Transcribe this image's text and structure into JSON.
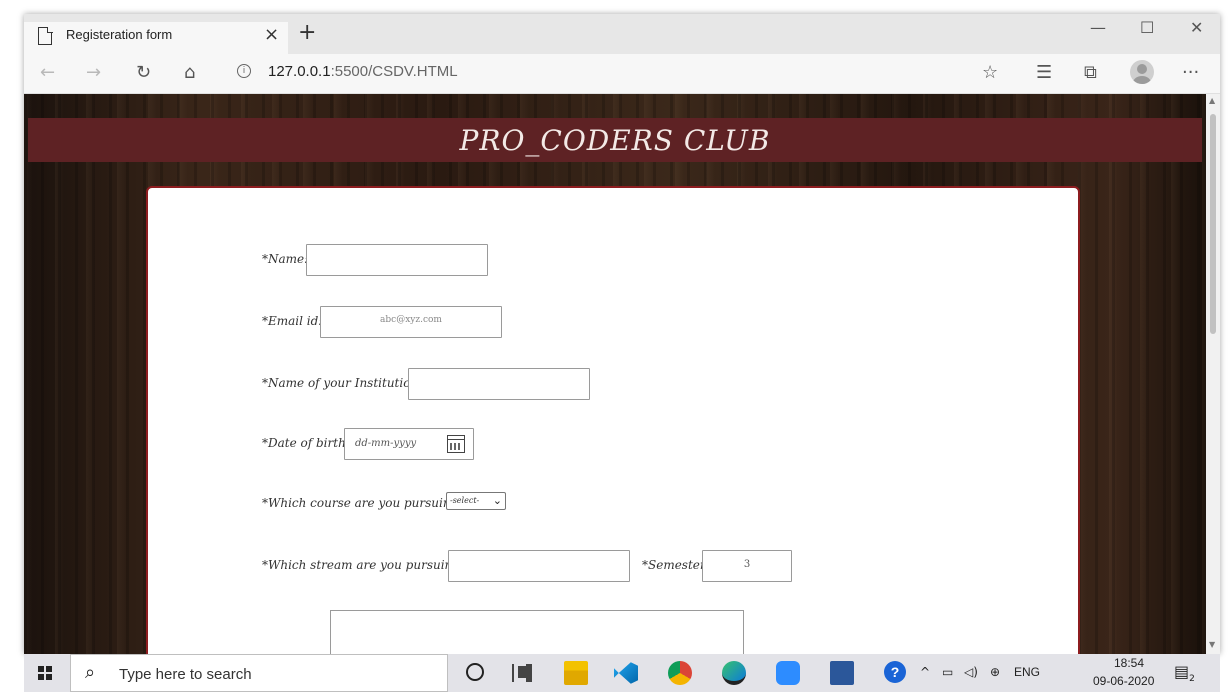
{
  "browser": {
    "tab_title": "Registeration form",
    "tab_close": "×",
    "new_tab": "+",
    "minimize": "—",
    "maximize": "☐",
    "close": "✕",
    "url_host": "127.0.0.1",
    "url_rest": ":5500/CSDV.HTML"
  },
  "page": {
    "club_title": "PRO_CODERS CLUB"
  },
  "form": {
    "name_label": "*Name:",
    "email_label": "*Email id:",
    "email_placeholder": "abc@xyz.com",
    "institution_label": "*Name of your Institution:",
    "dob_label": "*Date of birth:",
    "dob_placeholder": "dd-mm-yyyy",
    "course_label": "*Which course are you pursuing?",
    "course_selected": "-select-",
    "stream_label": "*Which stream are you pursuing?",
    "semester_label": "*Semester:",
    "semester_value": "3"
  },
  "taskbar": {
    "search_placeholder": "Type here to search",
    "language": "ENG",
    "time": "18:54",
    "date": "09-06-2020",
    "notification_count": "2"
  },
  "colors": {
    "banner": "#5e2224",
    "card_border": "#8d1c1f"
  }
}
